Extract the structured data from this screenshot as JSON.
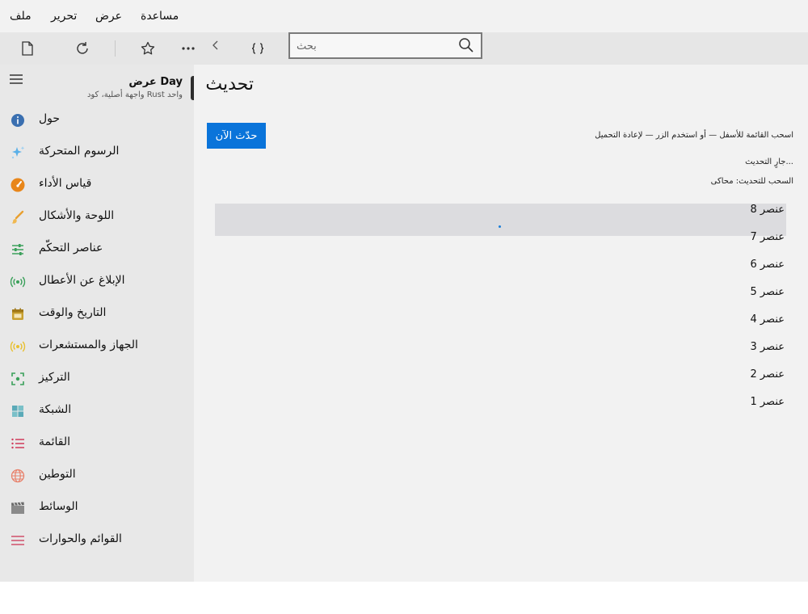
{
  "menu": {
    "file": "ملف",
    "edit": "تحرير",
    "view": "عرض",
    "help": "مساعدة"
  },
  "search": {
    "placeholder": "بحث",
    "value": ""
  },
  "toolbar_icons": [
    "new-document-icon",
    "refresh-icon",
    "star-icon",
    "more-icon",
    "chevron-left-icon",
    "code-braces-icon",
    "search-icon"
  ],
  "sidebar": {
    "title": "عرض Day",
    "subtitle": "واجهة أصلية، كود Rust واحد",
    "items": [
      {
        "label": "حول",
        "icon": "info-icon",
        "color": "#3a6fb0"
      },
      {
        "label": "الرسوم المتحركة",
        "icon": "sparkle-icon",
        "color": "#5ab0e8"
      },
      {
        "label": "قياس الأداء",
        "icon": "gauge-icon",
        "color": "#e8861a"
      },
      {
        "label": "اللوحة والأشكال",
        "icon": "brush-icon",
        "color": "#e8a030"
      },
      {
        "label": "عناصر التحكّم",
        "icon": "sliders-icon",
        "color": "#3aa05a"
      },
      {
        "label": "الإبلاغ عن الأعطال",
        "icon": "broadcast-icon",
        "color": "#3aa05a"
      },
      {
        "label": "التاريخ والوقت",
        "icon": "calendar-icon",
        "color": "#c8a030"
      },
      {
        "label": "الجهاز والمستشعرات",
        "icon": "sensor-icon",
        "color": "#e8c030"
      },
      {
        "label": "التركيز",
        "icon": "focus-icon",
        "color": "#3aa05a"
      },
      {
        "label": "الشبكة",
        "icon": "grid-icon",
        "color": "#5aaab8"
      },
      {
        "label": "القائمة",
        "icon": "list-icon",
        "color": "#d03a5a"
      },
      {
        "label": "التوطين",
        "icon": "globe-icon",
        "color": "#e8806a"
      },
      {
        "label": "الوسائط",
        "icon": "clapper-icon",
        "color": "#8a8a8a"
      },
      {
        "label": "القوائم والحوارات",
        "icon": "menu-lines-icon",
        "color": "#d0506a"
      }
    ]
  },
  "main": {
    "title": "تحديث",
    "refresh_button": "حدّث الآن",
    "hint": "اسحب القائمة للأسفل — أو استخدم الزر — لإعادة التحميل",
    "status": "جارٍ التحديث...",
    "pull_state": "السحب للتحديث: محاكى",
    "items": [
      "عنصر 8",
      "عنصر 7",
      "عنصر 6",
      "عنصر 5",
      "عنصر 4",
      "عنصر 3",
      "عنصر 2",
      "عنصر 1"
    ]
  },
  "colors": {
    "accent": "#0a74da",
    "selection": "#dcdcdf",
    "sidebar_bg": "#e8e8e8",
    "content_bg": "#f2f2f2"
  }
}
